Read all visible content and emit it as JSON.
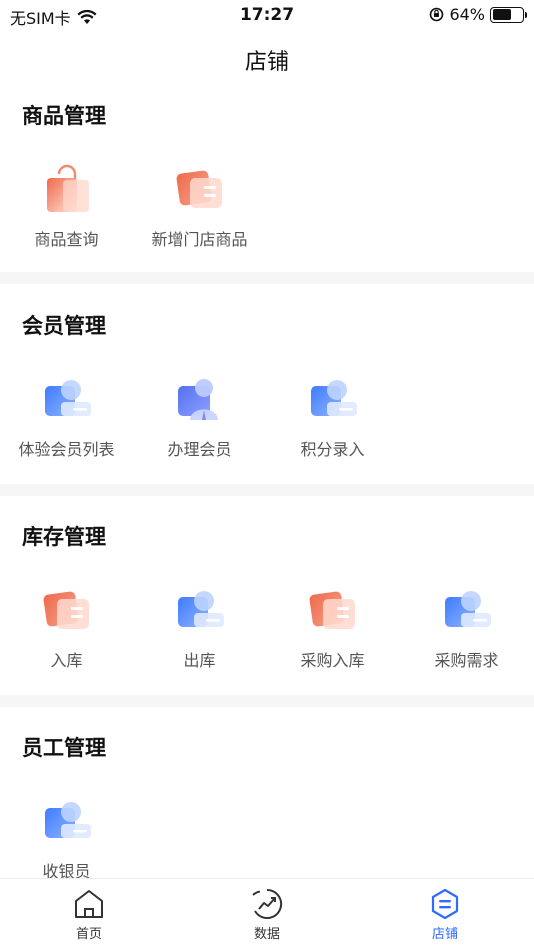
{
  "status_bar": {
    "carrier": "无SIM卡",
    "time": "17:27",
    "battery_percent": "64%",
    "battery_level": 0.64
  },
  "nav": {
    "title": "店铺"
  },
  "sections": {
    "goods": {
      "title": "商品管理",
      "items": [
        {
          "label": "商品查询",
          "icon": "shopping-bag-icon"
        },
        {
          "label": "新增门店商品",
          "icon": "card-stack-icon"
        }
      ]
    },
    "members": {
      "title": "会员管理",
      "items": [
        {
          "label": "体验会员列表",
          "icon": "member-card-icon"
        },
        {
          "label": "办理会员",
          "icon": "user-badge-icon"
        },
        {
          "label": "积分录入",
          "icon": "member-card-icon"
        }
      ]
    },
    "stock": {
      "title": "库存管理",
      "items": [
        {
          "label": "入库",
          "icon": "card-stack-icon"
        },
        {
          "label": "出库",
          "icon": "member-card-icon"
        },
        {
          "label": "采购入库",
          "icon": "card-stack-icon"
        },
        {
          "label": "采购需求",
          "icon": "member-card-icon"
        }
      ]
    },
    "staff": {
      "title": "员工管理",
      "items": [
        {
          "label": "收银员",
          "icon": "member-card-icon"
        }
      ]
    }
  },
  "tabbar": {
    "items": [
      {
        "label": "首页",
        "icon": "home-icon"
      },
      {
        "label": "数据",
        "icon": "chart-trend-icon"
      },
      {
        "label": "店铺",
        "icon": "store-icon"
      }
    ],
    "active_color": "#2f6bff"
  },
  "colors": {
    "orange_start": "#ef6a4b",
    "orange_end": "#ffd9cc",
    "blue_start": "#3f7bff",
    "blue_end": "#cfe0ff"
  }
}
